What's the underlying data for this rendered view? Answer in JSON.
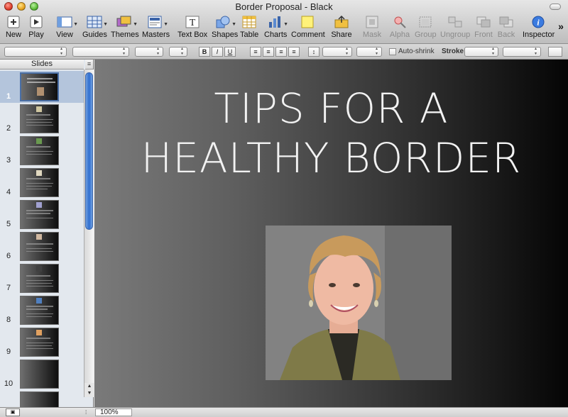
{
  "window": {
    "title": "Border Proposal - Black"
  },
  "toolbar": {
    "new": "New",
    "play": "Play",
    "view": "View",
    "guides": "Guides",
    "themes": "Themes",
    "masters": "Masters",
    "text_box": "Text Box",
    "shapes": "Shapes",
    "table": "Table",
    "charts": "Charts",
    "comment": "Comment",
    "share": "Share",
    "mask": "Mask",
    "alpha": "Alpha",
    "group": "Group",
    "ungroup": "Ungroup",
    "front": "Front",
    "back": "Back",
    "inspector": "Inspector",
    "overflow": "»"
  },
  "formatbar": {
    "bold": "B",
    "italic": "I",
    "underline": "U",
    "auto_shrink": "Auto-shrink",
    "stroke": "Stroke:"
  },
  "sidebar": {
    "header": "Slides",
    "slide_numbers": [
      "1",
      "2",
      "3",
      "4",
      "5",
      "6",
      "7",
      "8",
      "9",
      "10"
    ]
  },
  "slide": {
    "title_line1": "TIPS FOR A",
    "title_line2": "HEALTHY BORDER",
    "background_colors": [
      "#7a7a7a",
      "#050505"
    ]
  },
  "statusbar": {
    "zoom": "100%"
  }
}
